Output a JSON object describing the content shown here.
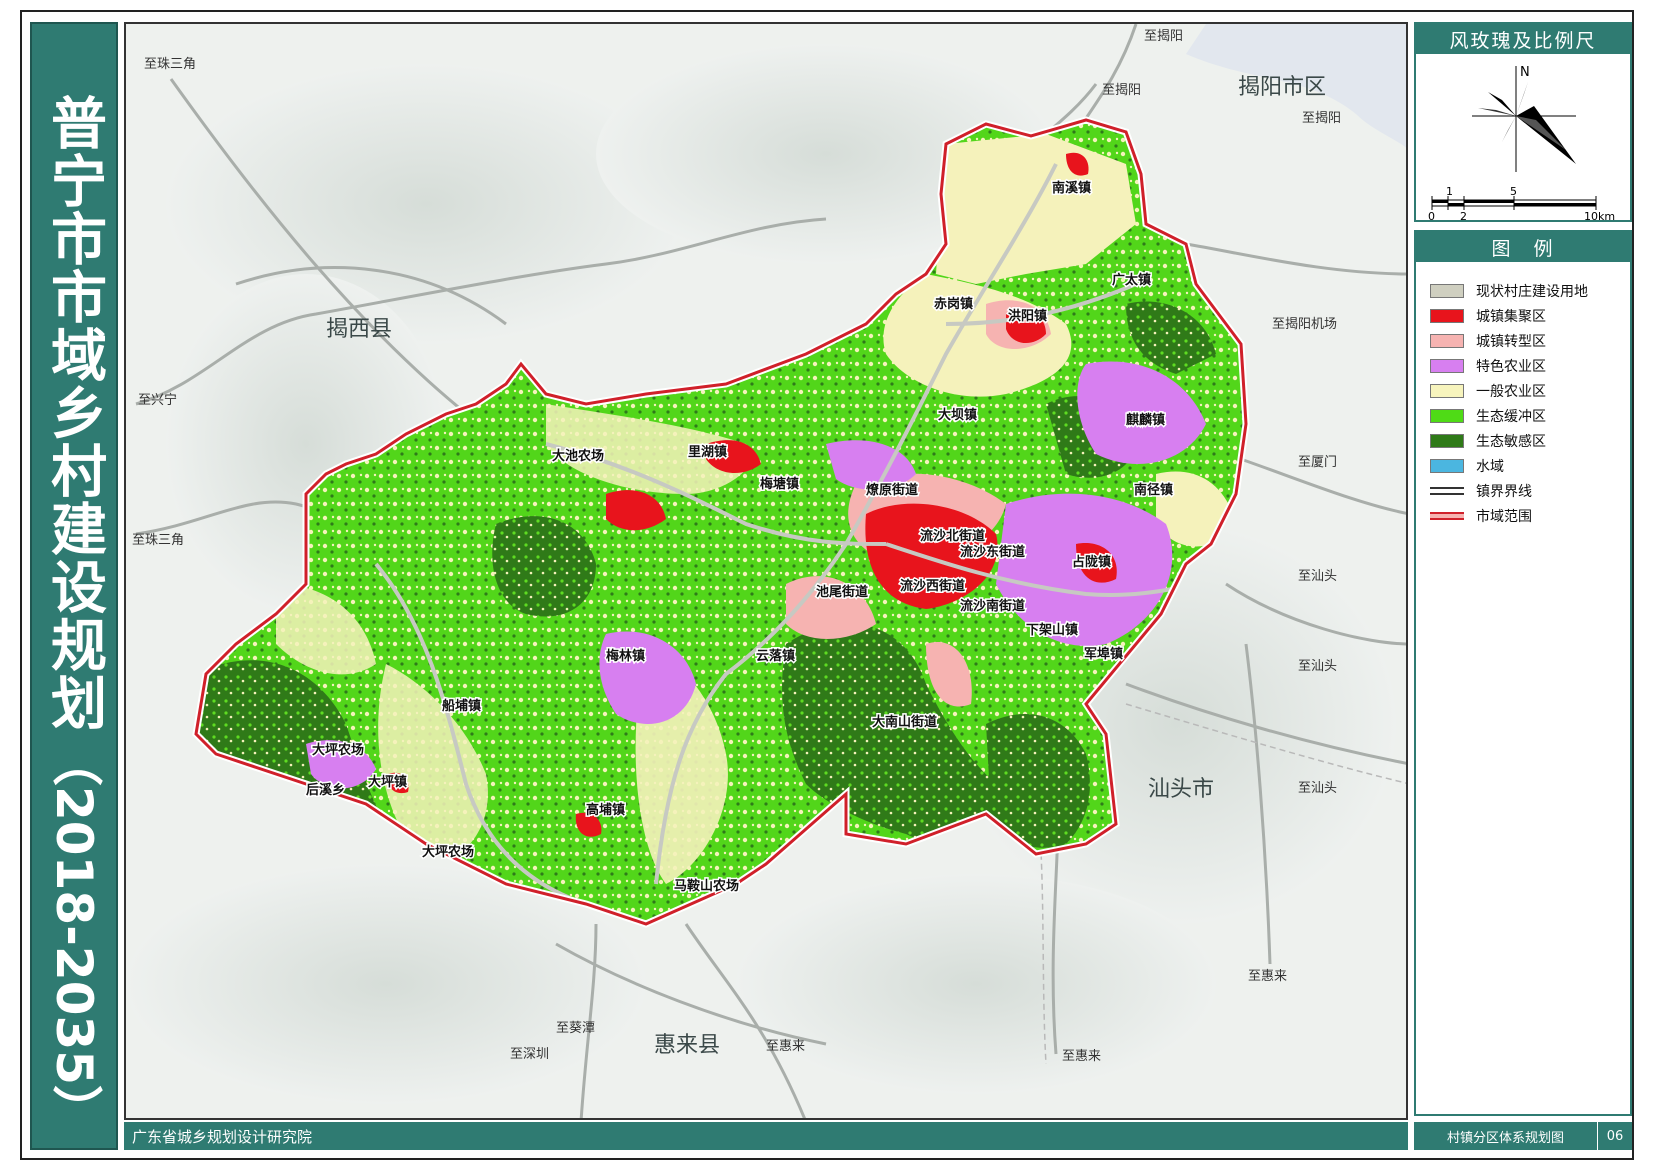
{
  "title": {
    "main": "普宁市市域乡村建设规划",
    "years": "（2018-2035）"
  },
  "footer": {
    "institute": "广东省城乡规划设计研究院",
    "sheet_name": "村镇分区体系规划图",
    "sheet_number": "06"
  },
  "compass_panel": {
    "header": "风玫瑰及比例尺",
    "north_label": "N",
    "scale_top_labels": [
      "1",
      "5"
    ],
    "scale_bottom_labels": [
      "0",
      "2",
      "10km"
    ]
  },
  "legend": {
    "header": "图　例",
    "items": [
      {
        "label": "现状村庄建设用地",
        "color": "#cfcfc0",
        "icon": "rect"
      },
      {
        "label": "城镇集聚区",
        "color": "#e8141c",
        "icon": "rect"
      },
      {
        "label": "城镇转型区",
        "color": "#f6b3b1",
        "icon": "rect"
      },
      {
        "label": "特色农业区",
        "color": "#d77ff0",
        "icon": "rect"
      },
      {
        "label": "一般农业区",
        "color": "#f7f4bd",
        "icon": "rect"
      },
      {
        "label": "生态缓冲区",
        "color": "#4fdb16",
        "icon": "rect"
      },
      {
        "label": "生态敏感区",
        "color": "#2f7a18",
        "icon": "rect"
      },
      {
        "label": "水域",
        "color": "#4bb6e0",
        "icon": "rect"
      },
      {
        "label": "镇界界线",
        "color": "#333333",
        "icon": "double-line"
      },
      {
        "label": "市域范围",
        "color": "#d0202a",
        "icon": "red-line"
      }
    ]
  },
  "map": {
    "neighbors": [
      "揭阳市区",
      "揭西县",
      "汕头市",
      "惠来县"
    ],
    "route_labels": [
      "至揭阳",
      "至揭阳",
      "至揭阳",
      "至珠三角",
      "至揭阳机场",
      "至兴宁",
      "至厦门",
      "至珠三角",
      "至汕头",
      "至汕头",
      "至汕头",
      "至惠来",
      "至葵潭",
      "至深圳",
      "至惠来",
      "至惠来"
    ],
    "towns": [
      "南溪镇",
      "广太镇",
      "赤岗镇",
      "洪阳镇",
      "大坝镇",
      "麒麟镇",
      "里湖镇",
      "大池农场",
      "梅塘镇",
      "燎原街道",
      "南径镇",
      "流沙北街道",
      "流沙东街道",
      "占陇镇",
      "池尾街道",
      "流沙西街道",
      "流沙南街道",
      "下架山镇",
      "军埠镇",
      "梅林镇",
      "云落镇",
      "船埔镇",
      "大南山街道",
      "大坪农场",
      "大坪镇",
      "后溪乡",
      "高埔镇",
      "大坪农场",
      "马鞍山农场"
    ]
  },
  "colors": {
    "accent": "#2f7b72",
    "boundary": "#d0202a"
  }
}
